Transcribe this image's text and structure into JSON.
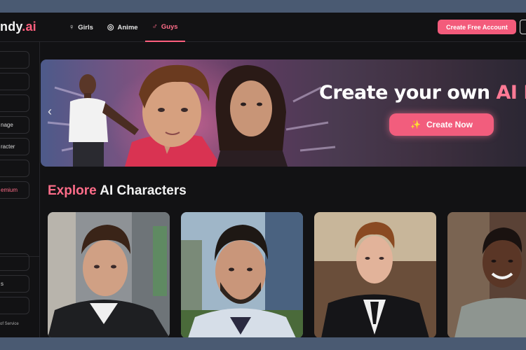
{
  "header": {
    "logo_text": "ndy",
    "logo_suffix": ".ai",
    "nav": [
      {
        "label": "Girls",
        "icon": "female-icon"
      },
      {
        "label": "Anime",
        "icon": "anime-icon"
      },
      {
        "label": "Guys",
        "icon": "male-icon"
      }
    ],
    "active_nav": "Guys",
    "create_account_label": "Create Free Account"
  },
  "sidebar": {
    "items": [
      {
        "label": ""
      },
      {
        "label": ""
      },
      {
        "label": ""
      },
      {
        "label": "nage"
      },
      {
        "label": "racter"
      },
      {
        "label": ""
      },
      {
        "label": "emium"
      },
      {
        "label": ""
      },
      {
        "label": "s"
      },
      {
        "label": ""
      }
    ],
    "footer": "of Service"
  },
  "banner": {
    "headline_prefix": "Create your own ",
    "headline_accent": "AI Boyfr",
    "cta_label": "Create Now"
  },
  "explore": {
    "title_accent": "Explore",
    "title_rest": " AI Characters"
  },
  "colors": {
    "accent": "#ff5f7e",
    "background": "#121214",
    "page_bg": "#4a5a72"
  }
}
